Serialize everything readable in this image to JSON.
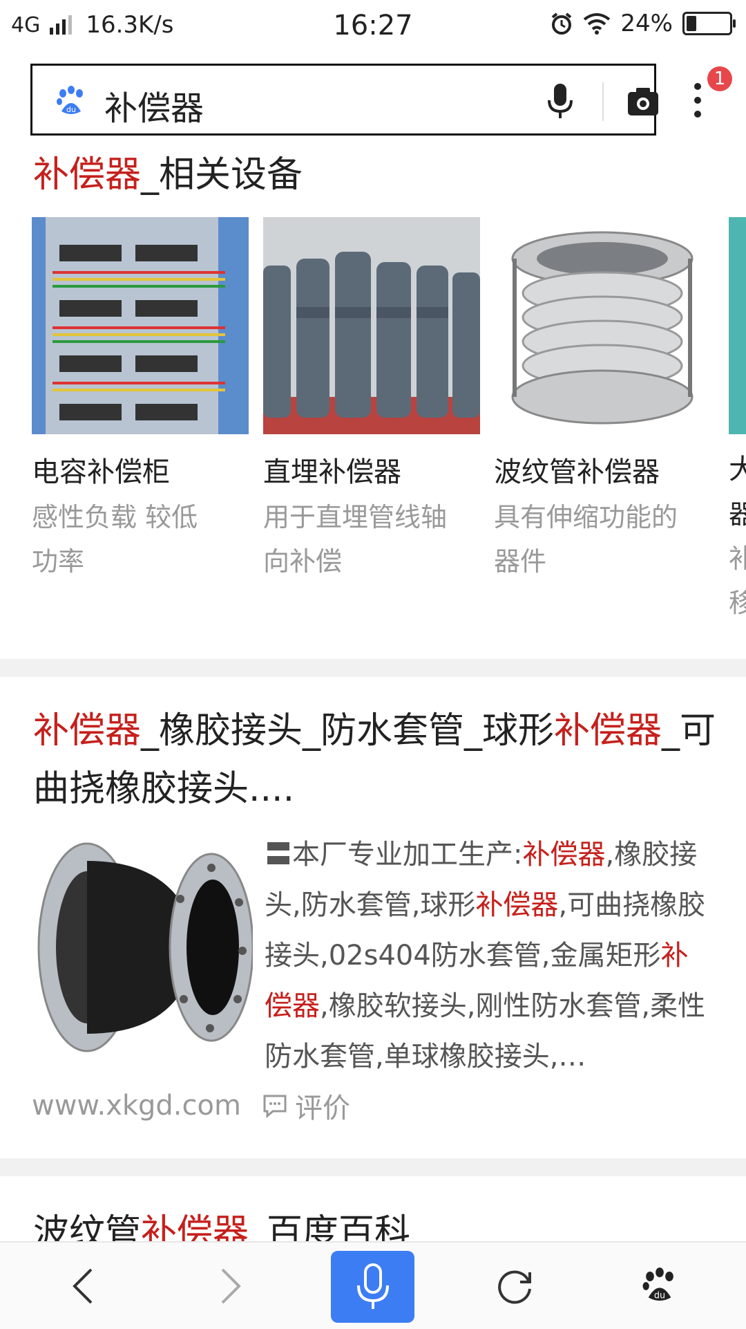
{
  "status_bar": {
    "network": "4G",
    "speed": "16.3K/s",
    "time": "16:27",
    "battery": "24%",
    "battery_level": 0.24
  },
  "search": {
    "query": "补偿器",
    "notification_count": "1"
  },
  "related": {
    "title_highlight": "补偿器",
    "title_rest": "_相关设备",
    "cards": [
      {
        "title": "电容补偿柜",
        "desc": "感性负载 较低功率"
      },
      {
        "title": "直埋补偿器",
        "desc": "用于直埋管线轴向补偿"
      },
      {
        "title": "波纹管补偿器",
        "desc": "具有伸缩功能的器件"
      },
      {
        "title": "大",
        "desc": "器\n补\n移"
      }
    ]
  },
  "result1": {
    "title_parts": [
      "补偿器",
      "_橡胶接头_防水套管_球形",
      "补偿器",
      "_可曲挠橡胶接头...."
    ],
    "snippet_parts": [
      "〓本厂专业加工生产:",
      "补偿器",
      ",橡胶接头,防水套管,球形",
      "补偿器",
      ",可曲挠橡胶接头,02s404防水套管,金属矩形",
      "补偿器",
      ",橡胶软接头,刚性防水套管,柔性防水套管,单球橡胶接头,…"
    ],
    "url": "www.xkgd.com",
    "comment_label": "评价"
  },
  "result2": {
    "title_parts": [
      "波纹管",
      "补偿器",
      "_百度百科"
    ]
  },
  "nav": {
    "back": "back-icon",
    "forward": "forward-icon",
    "voice": "microphone-icon",
    "refresh": "refresh-icon",
    "home": "baidu-paw-icon"
  },
  "colors": {
    "highlight": "#c5201c",
    "voice_button": "#3c7df3",
    "baidu_blue": "#3c7df3",
    "badge": "#e7474a"
  }
}
